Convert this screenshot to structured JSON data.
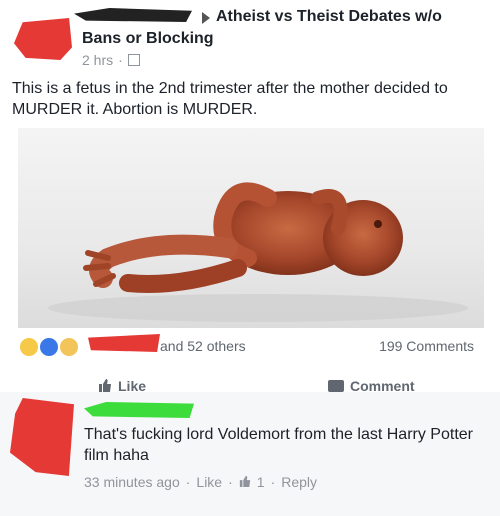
{
  "post": {
    "group_name_part1": "Atheist vs Theist Debates w/o",
    "group_name_part2": "Bans or Blocking",
    "time": "2 hrs",
    "text": "This is a fetus in the 2nd trimester after the mother decided to MURDER it. Abortion is MURDER."
  },
  "reactions": {
    "others": "and 52 others",
    "comments": "199 Comments"
  },
  "actions": {
    "like": "Like",
    "comment": "Comment"
  },
  "comment": {
    "text": "That's fucking lord Voldemort from the last Harry Potter film haha",
    "time": "33 minutes ago",
    "like": "Like",
    "like_count": "1",
    "reply": "Reply"
  },
  "colors": {
    "accent": "#3b78e7",
    "text": "#1d2129",
    "muted": "#90949c",
    "redaction_red": "#e53935",
    "redaction_green": "#3ddc3d"
  }
}
